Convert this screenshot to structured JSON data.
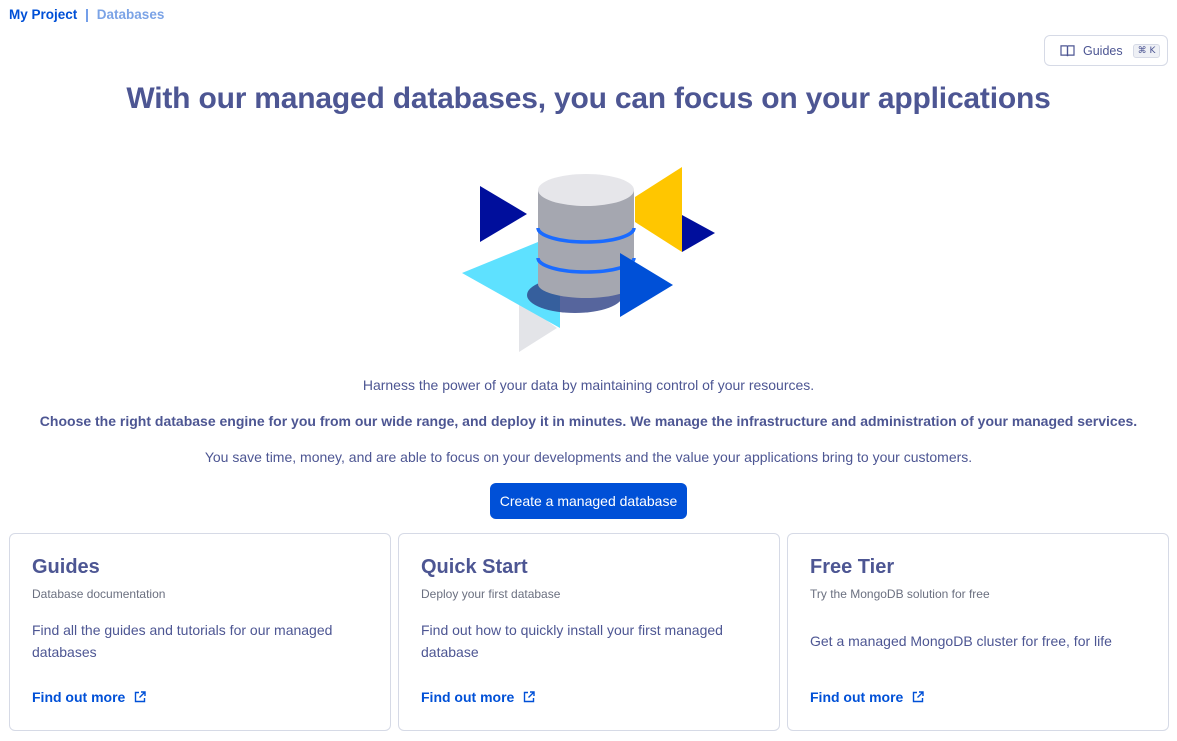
{
  "breadcrumb": {
    "root": "My Project",
    "separator": "|",
    "current": "Databases"
  },
  "guides_button": {
    "label": "Guides",
    "shortcut": "⌘ K",
    "icon": "book-icon"
  },
  "hero": {
    "title": "With our managed databases, you can focus on your applications",
    "paragraph_1": "Harness the power of your data by maintaining control of your resources.",
    "paragraph_2": "Choose the right database engine for you from our wide range, and deploy it in minutes. We manage the infrastructure and administration of your managed services.",
    "paragraph_3": "You save time, money, and are able to focus on your developments and the value your applications bring to your customers.",
    "cta_label": "Create a managed database"
  },
  "cards": [
    {
      "title": "Guides",
      "subtitle": "Database documentation",
      "description": "Find all the guides and tutorials for our managed databases",
      "link_label": "Find out more"
    },
    {
      "title": "Quick Start",
      "subtitle": "Deploy your first database",
      "description": "Find out how to quickly install your first managed database",
      "link_label": "Find out more"
    },
    {
      "title": "Free Tier",
      "subtitle": "Try the MongoDB solution for free",
      "description": "Get a managed MongoDB cluster for free, for life",
      "link_label": "Find out more"
    }
  ],
  "colors": {
    "primary": "#0050d7",
    "text": "#4d5693",
    "navy": "#000e9c",
    "cyan": "#5ee1ff",
    "yellow": "#ffc600",
    "border": "#d6dae6"
  }
}
